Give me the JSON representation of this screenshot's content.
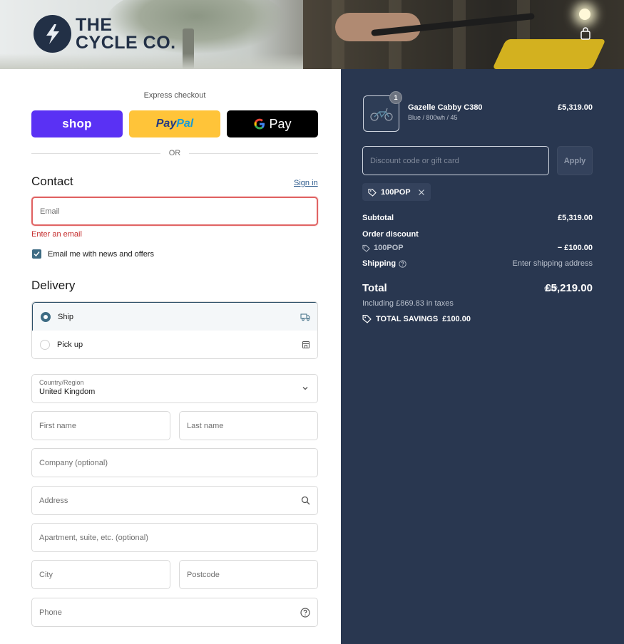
{
  "header": {
    "brand_line1": "THE",
    "brand_line2": "CYCLE CO.",
    "cart_icon": "shopping-bag-icon"
  },
  "express": {
    "title": "Express checkout",
    "shop_label": "shop",
    "paypal_label": "PayPal",
    "gpay_label": "Pay",
    "or_label": "OR"
  },
  "contact": {
    "heading": "Contact",
    "sign_in": "Sign in",
    "email_placeholder": "Email",
    "email_error": "Enter an email",
    "newsletter_label": "Email me with news and offers",
    "newsletter_checked": true
  },
  "delivery": {
    "heading": "Delivery",
    "options": [
      {
        "label": "Ship",
        "selected": true,
        "icon": "truck-icon"
      },
      {
        "label": "Pick up",
        "selected": false,
        "icon": "store-icon"
      }
    ],
    "country_label": "Country/Region",
    "country_value": "United Kingdom",
    "first_name": "First name",
    "last_name": "Last name",
    "company": "Company (optional)",
    "address": "Address",
    "apartment": "Apartment, suite, etc. (optional)",
    "city": "City",
    "postcode": "Postcode",
    "phone": "Phone"
  },
  "summary": {
    "product": {
      "name": "Gazelle Cabby C380",
      "variant": "Blue / 800wh / 45",
      "price": "£5,319.00",
      "quantity": "1"
    },
    "discount_placeholder": "Discount code or gift card",
    "apply_label": "Apply",
    "applied_code": "100POP",
    "subtotal_label": "Subtotal",
    "subtotal_value": "£5,319.00",
    "order_discount_label": "Order discount",
    "discount_code": "100POP",
    "discount_value": "− £100.00",
    "shipping_label": "Shipping",
    "shipping_value": "Enter shipping address",
    "total_label": "Total",
    "currency": "GBP",
    "total_value": "£5,219.00",
    "taxes_note": "Including £869.83 in taxes",
    "savings_label": "TOTAL SAVINGS",
    "savings_value": "£100.00"
  },
  "colors": {
    "summary_bg": "#293750",
    "shop_purple": "#5a31f4",
    "paypal_yellow": "#ffc439",
    "error_red": "#c42a2a",
    "accent_teal": "#3d6b83"
  }
}
